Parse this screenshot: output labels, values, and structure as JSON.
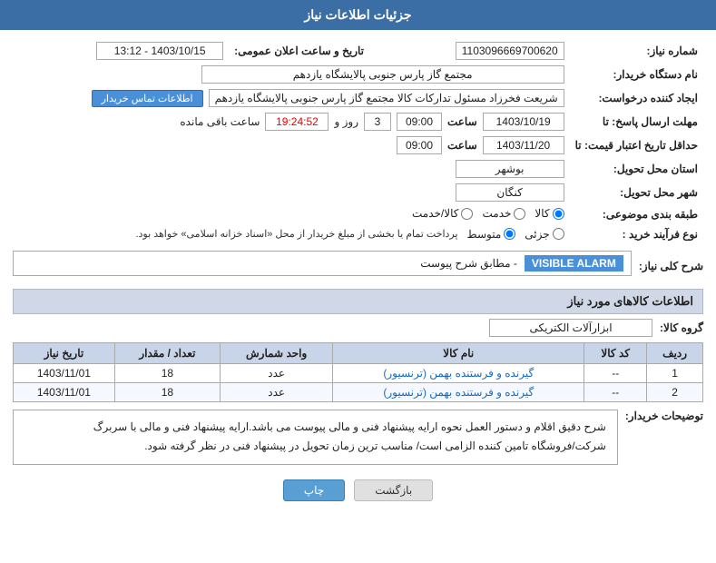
{
  "header": {
    "title": "جزئیات اطلاعات نیاز"
  },
  "fields": {
    "req_number_label": "شماره نیاز:",
    "req_number_value": "1103096669700620",
    "date_label": "تاریخ و ساعت اعلان عمومی:",
    "date_value": "1403/10/15 - 13:12",
    "buyer_label": "نام دستگاه خریدار:",
    "buyer_value": "مجتمع گاز پارس جنوبی  پالایشگاه یازدهم",
    "creator_label": "ایجاد کننده درخواست:",
    "creator_value": "شریعت فخرزاد مسئول تداركات كالا مجتمع گاز پارس جنوبی  پالایشگاه یازدهم",
    "contact_btn": "اطلاعات تماس خریدار",
    "response_deadline_label": "مهلت ارسال پاسخ: تا",
    "response_date": "1403/10/19",
    "response_time": "09:00",
    "response_days": "3",
    "response_days_label": "روز و",
    "response_remaining": "19:24:52",
    "response_remaining_label": "ساعت باقی مانده",
    "price_deadline_label": "حداقل تاریخ اعتبار قیمت: تا",
    "price_date": "1403/11/20",
    "price_time": "09:00",
    "province_label": "استان محل تحویل:",
    "province_value": "بوشهر",
    "city_label": "شهر محل تحویل:",
    "city_value": "كنگان",
    "category_label": "طبقه بندی موضوعی:",
    "category_options": [
      "کالا",
      "خدمت",
      "کالا/خدمت"
    ],
    "category_selected": "کالا",
    "purchase_type_label": "نوع فرآیند خرید :",
    "purchase_type_options": [
      "جزئی",
      "متوسط"
    ],
    "purchase_type_note": "پرداخت تمام یا بخشی از مبلغ خریدار از محل «اسناد خزانه اسلامی» خواهد بود.",
    "desc_label": "شرح کلی نیاز:",
    "alarm_label": "VISIBLE ALARM",
    "alarm_desc": "- مطابق شرح پیوست",
    "items_label": "اطلاعات کالاهای مورد نیاز",
    "group_label": "گروه کالا:",
    "group_value": "ابزارآلات الکتریکی",
    "table_headers": [
      "ردیف",
      "کد کالا",
      "نام کالا",
      "واحد شمارش",
      "تعداد / مقدار",
      "تاریخ نیاز"
    ],
    "table_rows": [
      {
        "row": "1",
        "code": "--",
        "name": "گیرنده و فرستنده بهمن (ترنسیور)",
        "unit": "عدد",
        "qty": "18",
        "date": "1403/11/01"
      },
      {
        "row": "2",
        "code": "--",
        "name": "گیرنده و فرستنده بهمن (ترنسیور)",
        "unit": "عدد",
        "qty": "18",
        "date": "1403/11/01"
      }
    ],
    "buyer_notes_label": "توضیحات خریدار:",
    "buyer_notes": "شرح دقیق اقلام و دستور العمل نحوه ارایه پیشنهاد فنی و مالی پیوست می باشد.ارایه پیشنهاد فنی و مالی با سربرگ\nشرکت/فروشگاه تامین کننده الزامی است/ مناسب ترین زمان تحویل در پیشنهاد فنی در نظر گرفته شود.",
    "btn_back": "بازگشت",
    "btn_print": "چاپ"
  }
}
